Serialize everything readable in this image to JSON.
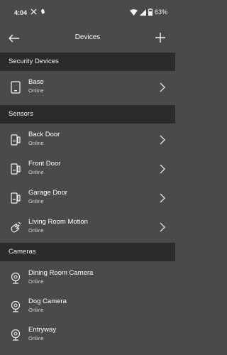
{
  "status_bar": {
    "time": "4:04",
    "battery": "63%"
  },
  "header": {
    "title": "Devices"
  },
  "sections": [
    {
      "title": "Security Devices",
      "items": [
        {
          "name": "Base",
          "status": "Online",
          "icon": "base-station-icon"
        }
      ]
    },
    {
      "title": "Sensors",
      "items": [
        {
          "name": "Back Door",
          "status": "Online",
          "icon": "door-sensor-icon"
        },
        {
          "name": "Front Door",
          "status": "Online",
          "icon": "door-sensor-icon"
        },
        {
          "name": "Garage Door",
          "status": "Online",
          "icon": "door-sensor-icon"
        },
        {
          "name": "Living Room Motion",
          "status": "Online",
          "icon": "motion-sensor-icon"
        }
      ]
    },
    {
      "title": "Cameras",
      "items": [
        {
          "name": "Dining Room Camera",
          "status": "Online",
          "icon": "camera-icon"
        },
        {
          "name": "Dog Camera",
          "status": "Online",
          "icon": "camera-icon"
        },
        {
          "name": "Entryway",
          "status": "Online",
          "icon": "camera-icon"
        }
      ]
    }
  ]
}
